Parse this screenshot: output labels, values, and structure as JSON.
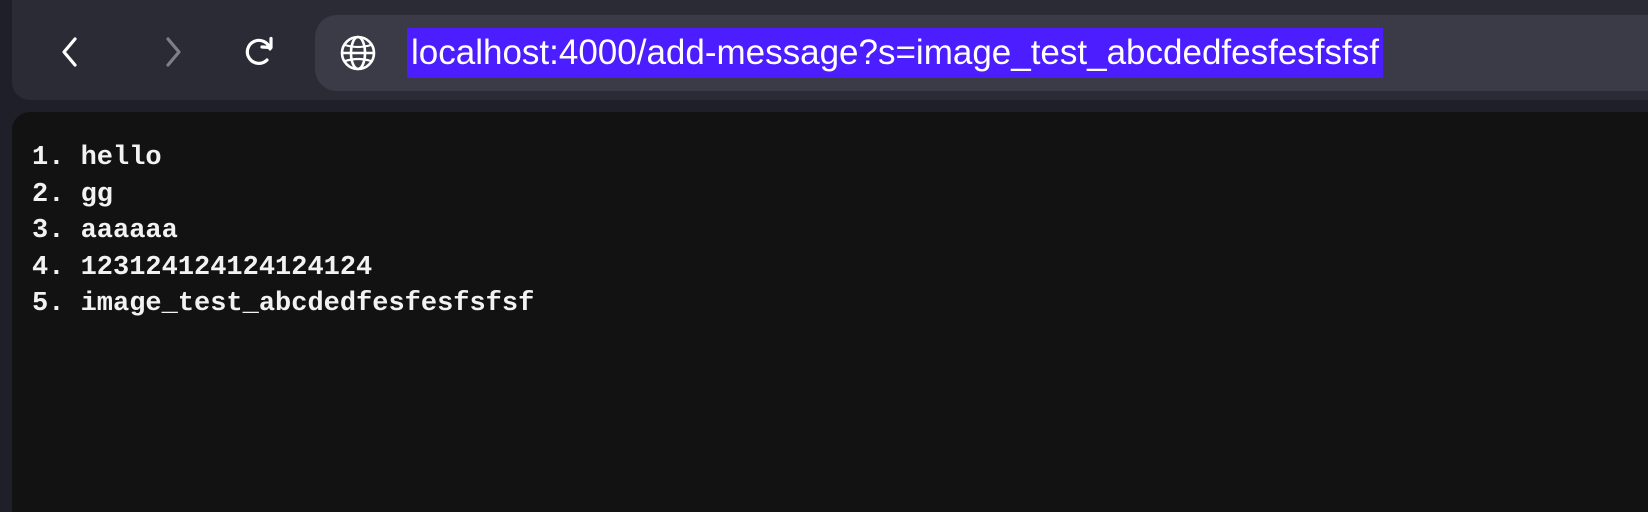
{
  "browser": {
    "url": "localhost:4000/add-message?s=image_test_abcdedfesfesfsfsf",
    "icons": {
      "back": "chevron-left-icon",
      "forward": "chevron-right-icon",
      "reload": "reload-icon",
      "site": "globe-icon"
    },
    "colors": {
      "url_selection": "#4b1dff",
      "page_background": "#121212"
    }
  },
  "messages": [
    "1. hello",
    "2. gg",
    "3. aaaaaa",
    "4. 12312412412412412­4",
    "5. image_test_abcdedfesfesfsfsf"
  ]
}
